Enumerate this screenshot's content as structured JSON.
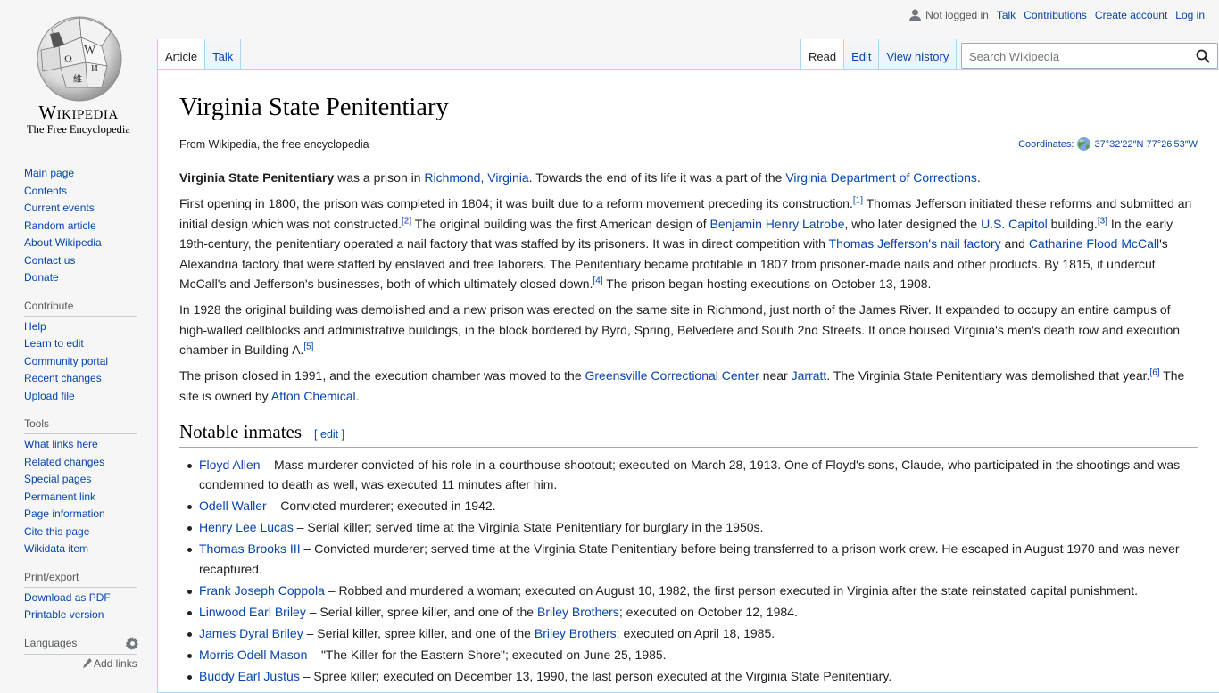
{
  "logo": {
    "wordmark": "Wikipedia",
    "tagline": "The Free Encyclopedia"
  },
  "sidebar": {
    "main_nav": [
      "Main page",
      "Contents",
      "Current events",
      "Random article",
      "About Wikipedia",
      "Contact us",
      "Donate"
    ],
    "contribute": {
      "heading": "Contribute",
      "items": [
        "Help",
        "Learn to edit",
        "Community portal",
        "Recent changes",
        "Upload file"
      ]
    },
    "tools": {
      "heading": "Tools",
      "items": [
        "What links here",
        "Related changes",
        "Special pages",
        "Permanent link",
        "Page information",
        "Cite this page",
        "Wikidata item"
      ]
    },
    "print": {
      "heading": "Print/export",
      "items": [
        "Download as PDF",
        "Printable version"
      ]
    },
    "languages": {
      "heading": "Languages",
      "add_links": "Add links"
    }
  },
  "personal": {
    "not_logged_in": "Not logged in",
    "talk": "Talk",
    "contributions": "Contributions",
    "create_account": "Create account",
    "login": "Log in"
  },
  "tabs": {
    "article": "Article",
    "talk": "Talk",
    "read": "Read",
    "edit": "Edit",
    "history": "View history"
  },
  "search": {
    "placeholder": "Search Wikipedia"
  },
  "article": {
    "title": "Virginia State Penitentiary",
    "site_sub": "From Wikipedia, the free encyclopedia",
    "coords_label": "Coordinates:",
    "coords_value": "37°32′22″N 77°26′53″W",
    "p1": [
      {
        "t": "Virginia State Penitentiary",
        "b": true
      },
      {
        "t": " was a prison in "
      },
      {
        "t": "Richmond, Virginia",
        "l": true
      },
      {
        "t": ". Towards the end of its life it was a part of the "
      },
      {
        "t": "Virginia Department of Corrections",
        "l": true
      },
      {
        "t": "."
      }
    ],
    "p2": [
      {
        "t": "First opening in 1800, the prison was completed in 1804; it was built due to a reform movement preceding its construction."
      },
      {
        "t": "[1]",
        "s": true
      },
      {
        "t": " Thomas Jefferson initiated these reforms and submitted an initial design which was not constructed."
      },
      {
        "t": "[2]",
        "s": true
      },
      {
        "t": " The original building was the first American design of "
      },
      {
        "t": "Benjamin Henry Latrobe",
        "l": true
      },
      {
        "t": ", who later designed the "
      },
      {
        "t": "U.S. Capitol",
        "l": true
      },
      {
        "t": " building."
      },
      {
        "t": "[3]",
        "s": true
      },
      {
        "t": " In the early 19th-century, the penitentiary operated a nail factory that was staffed by its prisoners. It was in direct competition with "
      },
      {
        "t": "Thomas Jefferson's nail factory",
        "l": true
      },
      {
        "t": " and "
      },
      {
        "t": "Catharine Flood McCall",
        "l": true
      },
      {
        "t": "'s Alexandria factory that were staffed by enslaved and free laborers. The Penitentiary became profitable in 1807 from prisoner-made nails and other products. By 1815, it undercut McCall's and Jefferson's businesses, both of which ultimately closed down."
      },
      {
        "t": "[4]",
        "s": true
      },
      {
        "t": " The prison began hosting executions on October 13, 1908."
      }
    ],
    "p3": [
      {
        "t": "In 1928 the original building was demolished and a new prison was erected on the same site in Richmond, just north of the James River. It expanded to occupy an entire campus of high-walled cellblocks and administrative buildings, in the block bordered by Byrd, Spring, Belvedere and South 2nd Streets. It once housed Virginia's men's death row and execution chamber in Building A."
      },
      {
        "t": "[5]",
        "s": true
      }
    ],
    "p4": [
      {
        "t": "The prison closed in 1991, and the execution chamber was moved to the "
      },
      {
        "t": "Greensville Correctional Center",
        "l": true
      },
      {
        "t": " near "
      },
      {
        "t": "Jarratt",
        "l": true
      },
      {
        "t": ". The Virginia State Penitentiary was demolished that year."
      },
      {
        "t": "[6]",
        "s": true
      },
      {
        "t": " The site is owned by "
      },
      {
        "t": "Afton Chemical",
        "l": true
      },
      {
        "t": "."
      }
    ],
    "section_title": "Notable inmates",
    "edit_label": "[ edit ]",
    "inmates": [
      [
        {
          "t": "Floyd Allen",
          "l": true
        },
        {
          "t": " – Mass murderer convicted of his role in a courthouse shootout; executed on March 28, 1913. One of Floyd's sons, Claude, who participated in the shootings and was condemned to death as well, was executed 11 minutes after him."
        }
      ],
      [
        {
          "t": "Odell Waller",
          "l": true
        },
        {
          "t": " – Convicted murderer; executed in 1942."
        }
      ],
      [
        {
          "t": "Henry Lee Lucas",
          "l": true
        },
        {
          "t": " – Serial killer; served time at the Virginia State Penitentiary for burglary in the 1950s."
        }
      ],
      [
        {
          "t": "Thomas Brooks III",
          "l": true
        },
        {
          "t": " – Convicted murderer; served time at the Virginia State Penitentiary before being transferred to a prison work crew. He escaped in August 1970 and was never recaptured."
        }
      ],
      [
        {
          "t": "Frank Joseph Coppola",
          "l": true
        },
        {
          "t": " – Robbed and murdered a woman; executed on August 10, 1982, the first person executed in Virginia after the state reinstated capital punishment."
        }
      ],
      [
        {
          "t": "Linwood Earl Briley",
          "l": true
        },
        {
          "t": " – Serial killer, spree killer, and one of the "
        },
        {
          "t": "Briley Brothers",
          "l": true
        },
        {
          "t": "; executed on October 12, 1984."
        }
      ],
      [
        {
          "t": "James Dyral Briley",
          "l": true
        },
        {
          "t": " – Serial killer, spree killer, and one of the "
        },
        {
          "t": "Briley Brothers",
          "l": true
        },
        {
          "t": "; executed on April 18, 1985."
        }
      ],
      [
        {
          "t": "Morris Odell Mason",
          "l": true
        },
        {
          "t": " – \"The Killer for the Eastern Shore\"; executed on June 25, 1985."
        }
      ],
      [
        {
          "t": "Buddy Earl Justus",
          "l": true
        },
        {
          "t": " – Spree killer; executed on December 13, 1990, the last person executed at the Virginia State Penitentiary."
        }
      ]
    ]
  }
}
